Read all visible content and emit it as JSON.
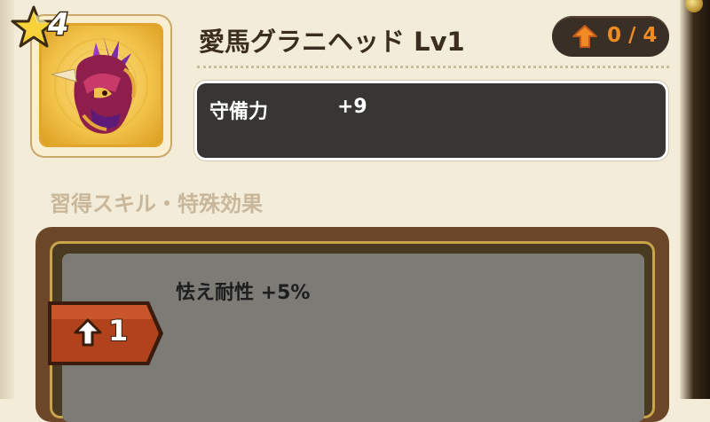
{
  "item": {
    "rarity_stars": "4",
    "title": "愛馬グラニヘッド Lv1",
    "icon": "horse-head-helmet-icon"
  },
  "upgrade": {
    "count": "0 / 4",
    "icon": "orange-up-arrow-icon"
  },
  "stats": [
    {
      "name": "守備力",
      "value": "+9"
    }
  ],
  "skills_section": {
    "title": "習得スキル・特殊効果",
    "entries": [
      {
        "level": "1",
        "effect": "怯え耐性 +5%"
      }
    ]
  },
  "colors": {
    "page_bg": "#f3ecd9",
    "stat_box_bg": "#383633",
    "accent_orange": "#f08c23",
    "level_tab_red": "#b0431c",
    "skill_panel_bg": "#7d7b76"
  }
}
